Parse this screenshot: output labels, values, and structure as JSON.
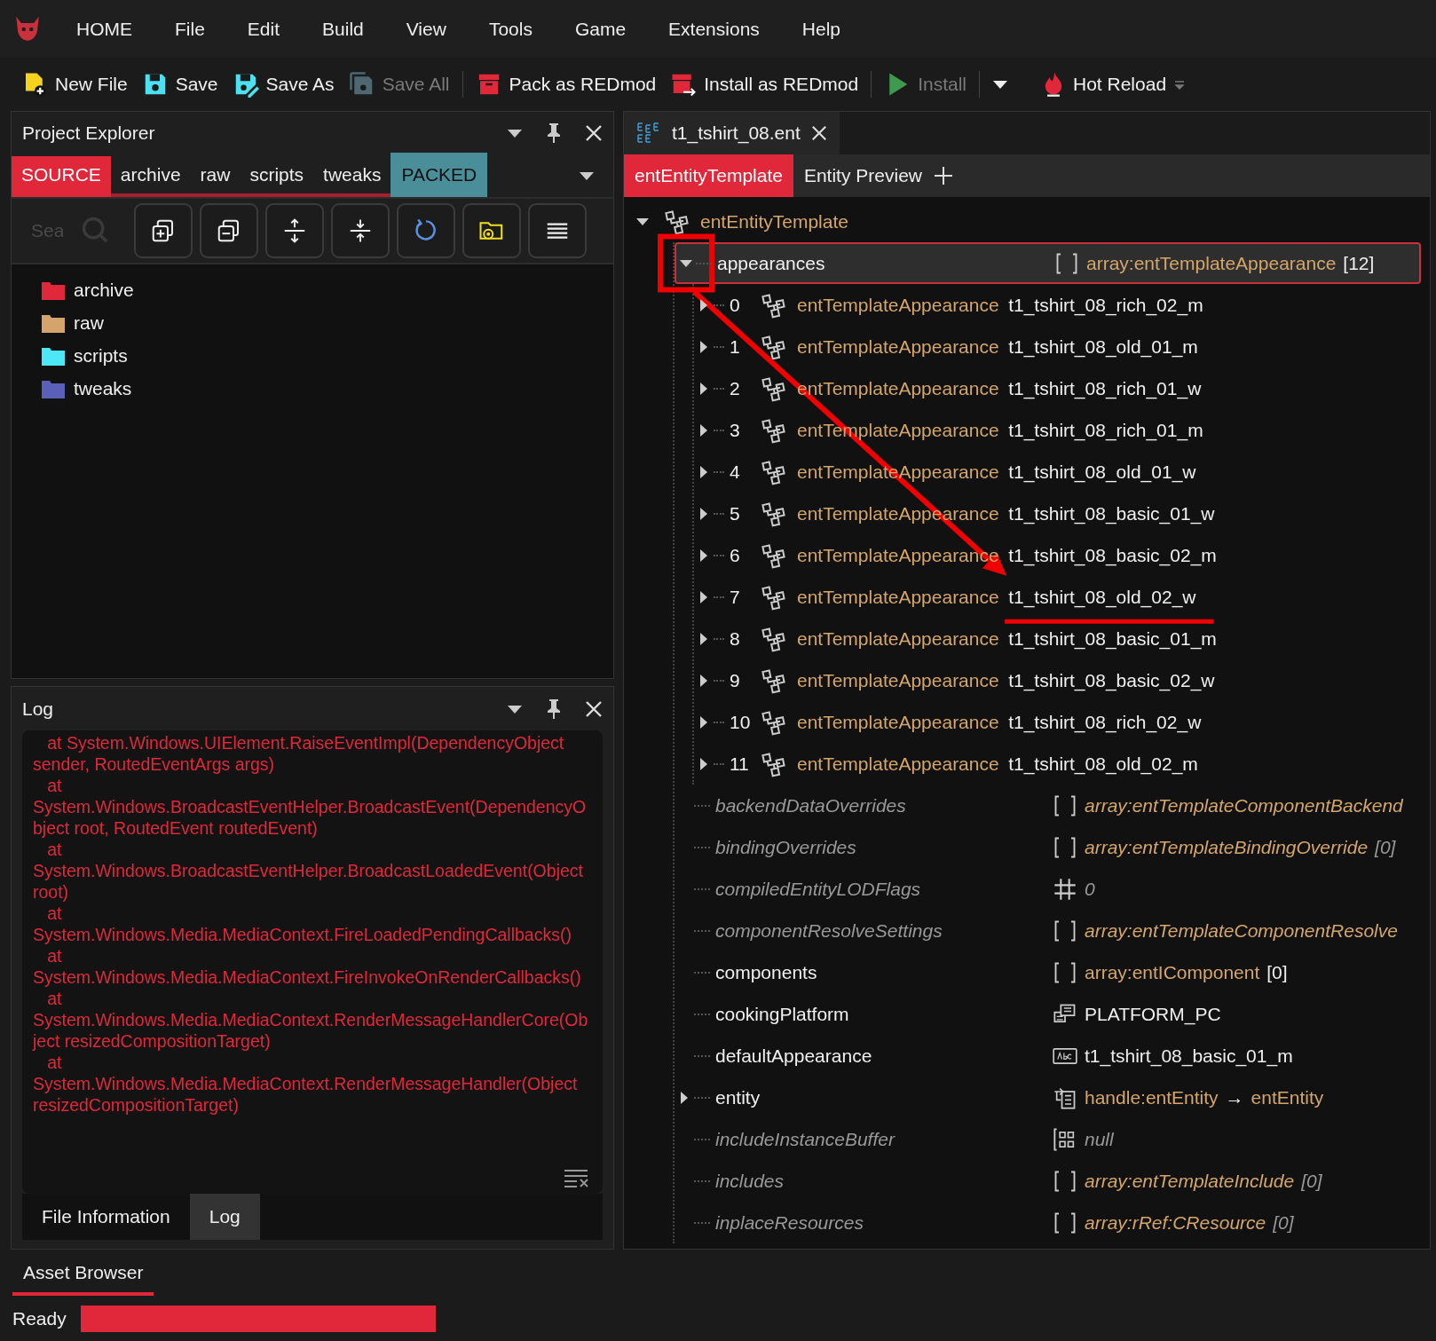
{
  "menu_bar": {
    "items": [
      "HOME",
      "File",
      "Edit",
      "Build",
      "View",
      "Tools",
      "Game",
      "Extensions",
      "Help"
    ]
  },
  "toolbar": {
    "buttons": [
      {
        "label": "New File",
        "disabled": false
      },
      {
        "label": "Save",
        "disabled": false
      },
      {
        "label": "Save As",
        "disabled": false
      },
      {
        "label": "Save All",
        "disabled": true
      },
      {
        "label": "Pack as REDmod",
        "disabled": false
      },
      {
        "label": "Install as REDmod",
        "disabled": false
      },
      {
        "label": "Install",
        "disabled": true
      }
    ],
    "hot_reload": {
      "label": "Hot Reload"
    }
  },
  "project_explorer": {
    "title": "Project Explorer",
    "tabs": [
      {
        "label": "SOURCE",
        "selected": true
      },
      {
        "label": "archive",
        "selected": false
      },
      {
        "label": "raw",
        "selected": false
      },
      {
        "label": "scripts",
        "selected": false
      },
      {
        "label": "tweaks",
        "selected": false
      }
    ],
    "packed_toggle": {
      "label": "PACKED",
      "on": true
    },
    "search": {
      "placeholder": "Sea"
    },
    "folders": [
      {
        "name": "archive",
        "color": "#e0283a"
      },
      {
        "name": "raw",
        "color": "#d4a46c"
      },
      {
        "name": "scripts",
        "color": "#4de8f8"
      },
      {
        "name": "tweaks",
        "color": "#5a5fb8"
      }
    ]
  },
  "log": {
    "title": "Log",
    "lines": [
      "   at System.Windows.UIElement.RaiseEventImpl(DependencyObject sender, RoutedEventArgs args)",
      "   at System.Windows.BroadcastEventHelper.BroadcastEvent(DependencyObject root, RoutedEvent routedEvent)",
      "   at System.Windows.BroadcastEventHelper.BroadcastLoadedEvent(Object root)",
      "   at System.Windows.Media.MediaContext.FireLoadedPendingCallbacks()",
      "   at System.Windows.Media.MediaContext.FireInvokeOnRenderCallbacks()",
      "   at System.Windows.Media.MediaContext.RenderMessageHandlerCore(Object resizedCompositionTarget)",
      "   at System.Windows.Media.MediaContext.RenderMessageHandler(Object resizedCompositionTarget)"
    ],
    "bottom_tabs": [
      {
        "label": "File Information",
        "selected": false
      },
      {
        "label": "Log",
        "selected": true
      }
    ]
  },
  "editor": {
    "document_tab": {
      "title": "t1_tshirt_08.ent"
    },
    "view_tabs": [
      {
        "label": "entEntityTemplate",
        "selected": true
      },
      {
        "label": "Entity Preview",
        "selected": false
      }
    ],
    "tree": {
      "root": {
        "label": "entEntityTemplate",
        "expanded": true
      },
      "properties": [
        {
          "name": "appearances",
          "kind": "array",
          "default": false,
          "expanded": true,
          "selected": true,
          "annotated": true,
          "value": [
            {
              "text": "array:entTemplateAppearance",
              "kind": "type"
            },
            {
              "text": "[12]",
              "kind": "count"
            }
          ],
          "children": [
            {
              "index": "0",
              "type": "entTemplateAppearance",
              "name": "t1_tshirt_08_rich_02_m",
              "expanded": false,
              "underlined": false
            },
            {
              "index": "1",
              "type": "entTemplateAppearance",
              "name": "t1_tshirt_08_old_01_m",
              "expanded": false,
              "underlined": false
            },
            {
              "index": "2",
              "type": "entTemplateAppearance",
              "name": "t1_tshirt_08_rich_01_w",
              "expanded": false,
              "underlined": false
            },
            {
              "index": "3",
              "type": "entTemplateAppearance",
              "name": "t1_tshirt_08_rich_01_m",
              "expanded": false,
              "underlined": false
            },
            {
              "index": "4",
              "type": "entTemplateAppearance",
              "name": "t1_tshirt_08_old_01_w",
              "expanded": false,
              "underlined": false
            },
            {
              "index": "5",
              "type": "entTemplateAppearance",
              "name": "t1_tshirt_08_basic_01_w",
              "expanded": false,
              "underlined": false
            },
            {
              "index": "6",
              "type": "entTemplateAppearance",
              "name": "t1_tshirt_08_basic_02_m",
              "expanded": false,
              "underlined": false
            },
            {
              "index": "7",
              "type": "entTemplateAppearance",
              "name": "t1_tshirt_08_old_02_w",
              "expanded": false,
              "underlined": true
            },
            {
              "index": "8",
              "type": "entTemplateAppearance",
              "name": "t1_tshirt_08_basic_01_m",
              "expanded": false,
              "underlined": false
            },
            {
              "index": "9",
              "type": "entTemplateAppearance",
              "name": "t1_tshirt_08_basic_02_w",
              "expanded": false,
              "underlined": false
            },
            {
              "index": "10",
              "type": "entTemplateAppearance",
              "name": "t1_tshirt_08_rich_02_w",
              "expanded": false,
              "underlined": false
            },
            {
              "index": "11",
              "type": "entTemplateAppearance",
              "name": "t1_tshirt_08_old_02_m",
              "expanded": false,
              "underlined": false
            }
          ]
        },
        {
          "name": "backendDataOverrides",
          "kind": "array",
          "default": true,
          "value": [
            {
              "text": "array:entTemplateComponentBackend",
              "kind": "type"
            }
          ]
        },
        {
          "name": "bindingOverrides",
          "kind": "array",
          "default": true,
          "value": [
            {
              "text": "array:entTemplateBindingOverride",
              "kind": "type"
            },
            {
              "text": "[0]",
              "kind": "count"
            }
          ]
        },
        {
          "name": "compiledEntityLODFlags",
          "kind": "number",
          "default": true,
          "value": [
            {
              "text": "0",
              "kind": "plain"
            }
          ]
        },
        {
          "name": "componentResolveSettings",
          "kind": "array",
          "default": true,
          "value": [
            {
              "text": "array:entTemplateComponentResolve",
              "kind": "type"
            }
          ]
        },
        {
          "name": "components",
          "kind": "array",
          "default": false,
          "value": [
            {
              "text": "array:entIComponent",
              "kind": "type"
            },
            {
              "text": "[0]",
              "kind": "count"
            }
          ]
        },
        {
          "name": "cookingPlatform",
          "kind": "enum",
          "default": false,
          "value": [
            {
              "text": "PLATFORM_PC",
              "kind": "plain"
            }
          ]
        },
        {
          "name": "defaultAppearance",
          "kind": "string",
          "default": false,
          "value": [
            {
              "text": "t1_tshirt_08_basic_01_m",
              "kind": "plain"
            }
          ]
        },
        {
          "name": "entity",
          "kind": "handle",
          "default": false,
          "expanded": false,
          "value": [
            {
              "text": "handle:entEntity",
              "kind": "type"
            },
            {
              "text": "→",
              "kind": "plain"
            },
            {
              "text": "entEntity",
              "kind": "type"
            }
          ]
        },
        {
          "name": "includeInstanceBuffer",
          "kind": "buffer",
          "default": true,
          "value": [
            {
              "text": "null",
              "kind": "plain"
            }
          ]
        },
        {
          "name": "includes",
          "kind": "array",
          "default": true,
          "value": [
            {
              "text": "array:entTemplateInclude",
              "kind": "type"
            },
            {
              "text": "[0]",
              "kind": "count"
            }
          ]
        },
        {
          "name": "inplaceResources",
          "kind": "array",
          "default": true,
          "value": [
            {
              "text": "array:rRef:CResource",
              "kind": "type"
            },
            {
              "text": "[0]",
              "kind": "count"
            }
          ]
        }
      ]
    }
  },
  "dock_tabs": [
    {
      "label": "Asset Browser",
      "selected": true
    }
  ],
  "status_bar": {
    "text": "Ready",
    "progress": {
      "level": 1
    }
  }
}
